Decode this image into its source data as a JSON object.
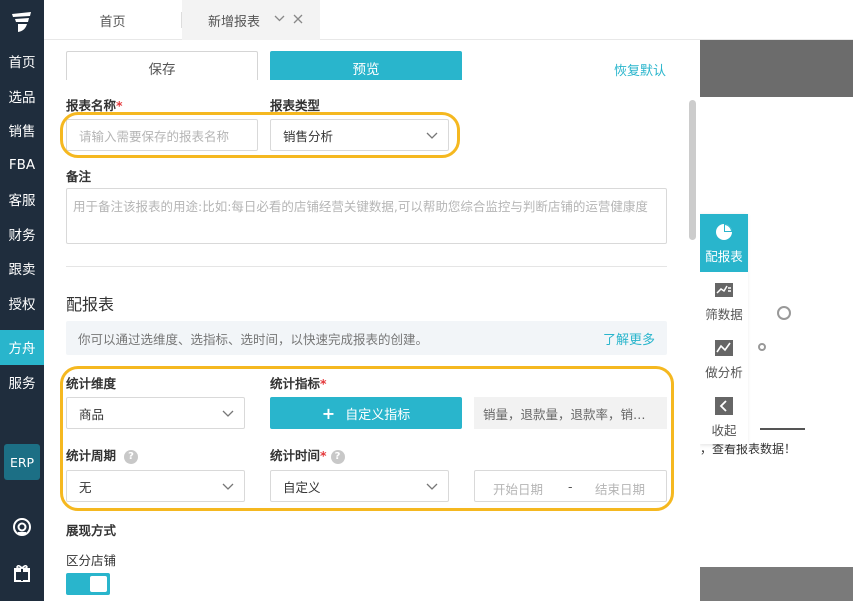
{
  "nav": {
    "items": [
      "首页",
      "选品",
      "销售",
      "FBA",
      "客服",
      "财务",
      "跟卖",
      "授权",
      "方舟",
      "服务"
    ],
    "active_index": 8,
    "erp_label": "ERP"
  },
  "tabs": {
    "home": "首页",
    "current": "新增报表"
  },
  "toolbar": {
    "save_label": "保存",
    "preview_label": "预览",
    "reset_label": "恢复默认"
  },
  "form": {
    "name_label": "报表名称",
    "name_placeholder": "请输入需要保存的报表名称",
    "type_label": "报表类型",
    "type_value": "销售分析",
    "note_label": "备注",
    "note_placeholder": "用于备注该报表的用途:比如:每日必看的店铺经营关键数据,可以帮助您综合监控与判断店铺的运营健康度"
  },
  "config": {
    "title": "配报表",
    "hint": "你可以通过选维度、选指标、选时间，以快速完成报表的创建。",
    "learn_more": "了解更多",
    "dimension_label": "统计维度",
    "dimension_value": "商品",
    "metric_label": "统计指标",
    "custom_metric_label": "自定义指标",
    "metrics_value": "销量，退款量，退款率，销…",
    "period_label": "统计周期",
    "period_value": "无",
    "time_label": "统计时间",
    "time_value": "自定义",
    "start_placeholder": "开始日期",
    "range_sep": "-",
    "end_placeholder": "结束日期"
  },
  "display": {
    "title": "展现方式",
    "split_store_label": "区分店铺",
    "split_store_on": true
  },
  "side_tools": [
    "配报表",
    "筛数据",
    "做分析",
    "收起"
  ],
  "overlay_text": "，查看报表数据！",
  "colors": {
    "accent": "#29b5cc",
    "nav_bg": "#1f2d3d",
    "highlight": "#f5b820",
    "required": "#e4393c"
  }
}
